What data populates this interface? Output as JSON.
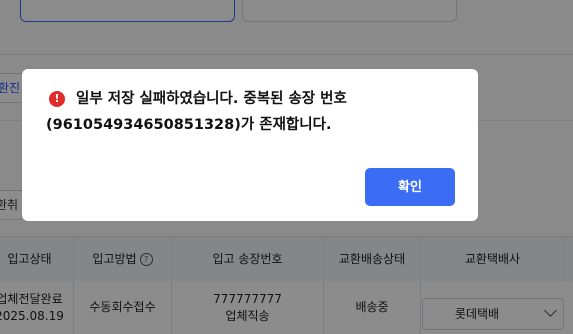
{
  "background": {
    "left_chip_label": "환진",
    "left_chip2_label": "환취",
    "table": {
      "headers": [
        "입고상태",
        "입고방법",
        "입고 송장번호",
        "교환배송상태",
        "교환택배사"
      ],
      "row": {
        "status_line1": "업체전달완료",
        "status_line2": "2025.08.19",
        "method": "수동회수접수",
        "invoice_line1": "777777777",
        "invoice_line2": "업체직송",
        "exchange_status": "배송중",
        "courier_selected": "롯데택배"
      }
    }
  },
  "dialog": {
    "icon": "error-icon",
    "icon_glyph": "!",
    "message_line1": "일부 저장 실패하였습니다. 중복된 송장 번호",
    "message_line2": "(961054934650851328)가 존재합니다.",
    "confirm_label": "확인"
  },
  "colors": {
    "accent": "#3a6cf4",
    "error": "#e02c2c"
  }
}
